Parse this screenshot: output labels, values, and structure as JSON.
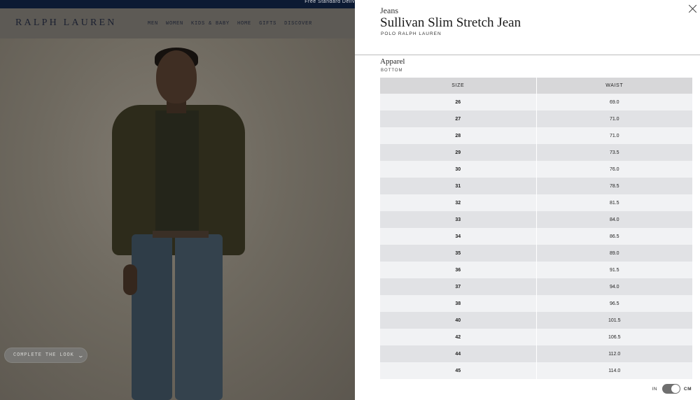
{
  "promo": {
    "text": "Free Standard Deliv"
  },
  "header": {
    "logo": "RALPH LAUREN",
    "nav": [
      "MEN",
      "WOMEN",
      "KIDS & BABY",
      "HOME",
      "GIFTS",
      "DISCOVER"
    ]
  },
  "hero": {
    "complete_look_label": "COMPLETE THE LOOK",
    "complete_look_icon": "chevron-down-icon"
  },
  "panel": {
    "category": "Jeans",
    "title": "Sullivan Slim Stretch Jean",
    "brand": "POLO RALPH LAUREN",
    "close_icon": "close-icon",
    "section": "Apparel",
    "subsection": "BOTTOM",
    "table": {
      "headers": [
        "SIZE",
        "WAIST"
      ],
      "rows": [
        [
          "26",
          "69.0"
        ],
        [
          "27",
          "71.0"
        ],
        [
          "28",
          "71.0"
        ],
        [
          "29",
          "73.5"
        ],
        [
          "30",
          "76.0"
        ],
        [
          "31",
          "78.5"
        ],
        [
          "32",
          "81.5"
        ],
        [
          "33",
          "84.0"
        ],
        [
          "34",
          "86.5"
        ],
        [
          "35",
          "89.0"
        ],
        [
          "36",
          "91.5"
        ],
        [
          "37",
          "94.0"
        ],
        [
          "38",
          "96.5"
        ],
        [
          "40",
          "101.5"
        ],
        [
          "42",
          "106.5"
        ],
        [
          "44",
          "112.0"
        ],
        [
          "45",
          "114.0"
        ]
      ]
    },
    "unit_toggle": {
      "left": "IN",
      "right": "CM",
      "selected": "CM"
    }
  },
  "colors": {
    "promo_bar": "#0c1a33",
    "table_header": "#d7d7d9",
    "toggle": "#6f6f6f"
  }
}
